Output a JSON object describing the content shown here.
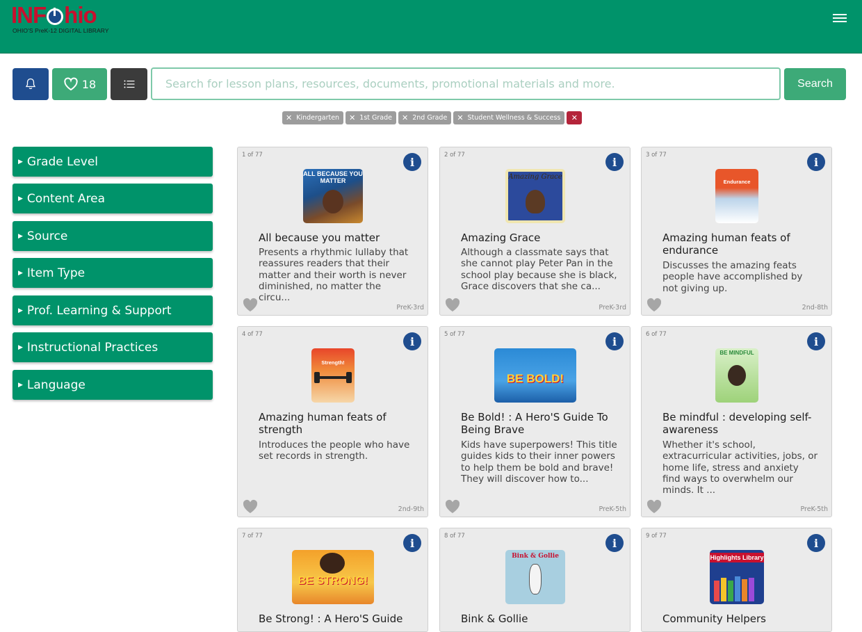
{
  "header": {
    "logo_text_red1": "INF",
    "logo_text_red2": "hio",
    "logo_subtitle": "OHIO'S PreK-12 DIGITAL LIBRARY",
    "menu_icon": "hamburger-icon"
  },
  "toolbar": {
    "bell_icon": "bell-icon",
    "favorites_count": "18",
    "list_icon": "list-icon",
    "search_placeholder": "Search for lesson plans, resources, documents, promotional materials and more.",
    "search_label": "Search"
  },
  "filters": [
    {
      "label": "Kindergarten"
    },
    {
      "label": "1st Grade"
    },
    {
      "label": "2nd Grade"
    },
    {
      "label": "Student Wellness & Success"
    }
  ],
  "sidebar": {
    "facets": [
      {
        "label": "Grade Level"
      },
      {
        "label": "Content Area"
      },
      {
        "label": "Source"
      },
      {
        "label": "Item Type"
      },
      {
        "label": "Prof. Learning & Support"
      },
      {
        "label": "Instructional Practices"
      },
      {
        "label": "Language"
      }
    ]
  },
  "results": [
    {
      "index": "1 of 77",
      "title": "All because you matter",
      "desc": "Presents a rhythmic lullaby that reassures readers that their matter and their worth is never diminished, no matter the circu...",
      "grade": "PreK-3rd",
      "cover_text": "ALL BECAUSE YOU MATTER"
    },
    {
      "index": "2 of 77",
      "title": "Amazing Grace",
      "desc": "Although a classmate says that she cannot play Peter Pan in the school play because she is black, Grace discovers that she ca...",
      "grade": "PreK-3rd",
      "cover_text": "Amazing Grace"
    },
    {
      "index": "3 of 77",
      "title": "Amazing human feats of endurance",
      "desc": "Discusses the amazing feats people have accomplished by not giving up.",
      "grade": "2nd-8th",
      "cover_text": "Endurance"
    },
    {
      "index": "4 of 77",
      "title": "Amazing human feats of strength",
      "desc": "Introduces the people who have set records in strength.",
      "grade": "2nd-9th",
      "cover_text": "Strength!"
    },
    {
      "index": "5 of 77",
      "title": "Be Bold! : A Hero'S Guide To Being Brave",
      "desc": "Kids have superpowers! This title guides kids to their inner powers to help them be bold and brave! They will discover how to...",
      "grade": "PreK-5th",
      "cover_text": "BE BOLD!"
    },
    {
      "index": "6 of 77",
      "title": "Be mindful : developing self-awareness",
      "desc": "Whether it's school, extracurricular activities, jobs, or home life, stress and anxiety find ways to overwhelm our minds. It ...",
      "grade": "PreK-5th",
      "cover_text": "BE MINDFUL"
    },
    {
      "index": "7 of 77",
      "title": "Be Strong! : A Hero'S Guide",
      "desc": "",
      "grade": "",
      "cover_text": "BE STRONG!"
    },
    {
      "index": "8 of 77",
      "title": "Bink & Gollie",
      "desc": "",
      "grade": "",
      "cover_text": "Bink & Gollie"
    },
    {
      "index": "9 of 77",
      "title": "Community Helpers",
      "desc": "",
      "grade": "",
      "cover_text": "Highlights Library"
    }
  ]
}
